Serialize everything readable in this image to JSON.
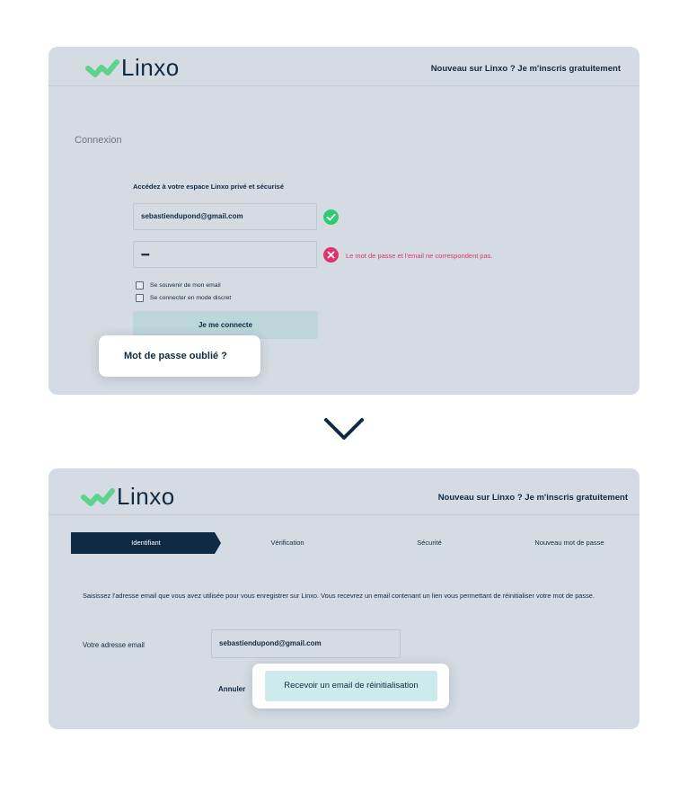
{
  "brand": {
    "name": "Linxo",
    "green": "#5fd38d",
    "navy": "#0f2a44"
  },
  "login": {
    "signup_link": "Nouveau sur Linxo ? Je m'inscris gratuitement",
    "page_label": "Connexion",
    "intro": "Accédez à votre espace Linxo privé et sécurisé",
    "email_value": "sebastiendupond@gmail.com",
    "email_status": "check-icon",
    "password_value": "••••",
    "password_status": "error-x-icon",
    "error_message": "Le mot de passe et l'email ne correspondent pas.",
    "remember_label": "Se souvenir de mon email",
    "discreet_label": "Se connecter en mode discret",
    "submit_label": "Je me connecte",
    "forgot_label": "Mot de passe oublié ?"
  },
  "transition_icon": "chevron-down-icon",
  "reset": {
    "signup_link": "Nouveau sur Linxo ? Je m'inscris gratuitement",
    "steps": [
      "Identifiant",
      "Vérification",
      "Sécurité",
      "Nouveau mot de passe"
    ],
    "active_step": 0,
    "description": "Saisissez l'adresse email que vous avez utilisée pour vous enregistrer sur Linxo. Vous recevrez un email contenant un lien vous permettant de réinitialiser votre mot de passe.",
    "email_label": "Votre adresse email",
    "email_value": "sebastiendupond@gmail.com",
    "cancel_label": "Annuler",
    "submit_label": "Recevoir un email de réinitialisation"
  },
  "colors": {
    "panel_bg": "#d5dbe2",
    "success": "#2ecc71",
    "error": "#e0336b",
    "button_teal": "#bcd6d9",
    "button_mint": "#cdebea"
  }
}
